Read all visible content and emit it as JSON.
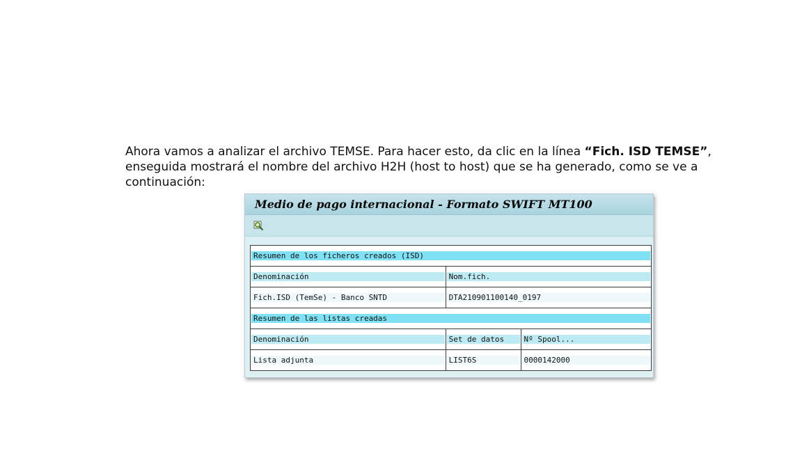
{
  "intro": {
    "part1": "Ahora vamos a analizar el archivo TEMSE. Para hacer esto, da clic en la línea ",
    "bold": "“Fich. ISD TEMSE”",
    "part2": ", enseguida mostrará el nombre del archivo H2H (host to host) que se ha generado, como se ve a continuación:"
  },
  "window": {
    "title": "Medio de pago internacional - Formato SWIFT MT100",
    "toolbar": {
      "icon": "zoom-detail-icon"
    }
  },
  "files_section": {
    "title": "Resumen de los ficheros creados (ISD)",
    "headers": [
      "Denominación",
      "Nom.fich."
    ],
    "rows": [
      [
        "Fich.ISD (TemSe) - Banco SNTD",
        "DTA210901100140_0197"
      ]
    ]
  },
  "lists_section": {
    "title": "Resumen de las listas creadas",
    "headers": [
      "Denominación",
      "Set de datos",
      "Nº Spool..."
    ],
    "rows": [
      [
        "Lista adjunta",
        "LIST6S",
        "0000142000"
      ]
    ]
  },
  "colors": {
    "section_bar": "#7fe1f3",
    "header_bar": "#bdeaf3",
    "title_bar": "#a9d3df"
  }
}
